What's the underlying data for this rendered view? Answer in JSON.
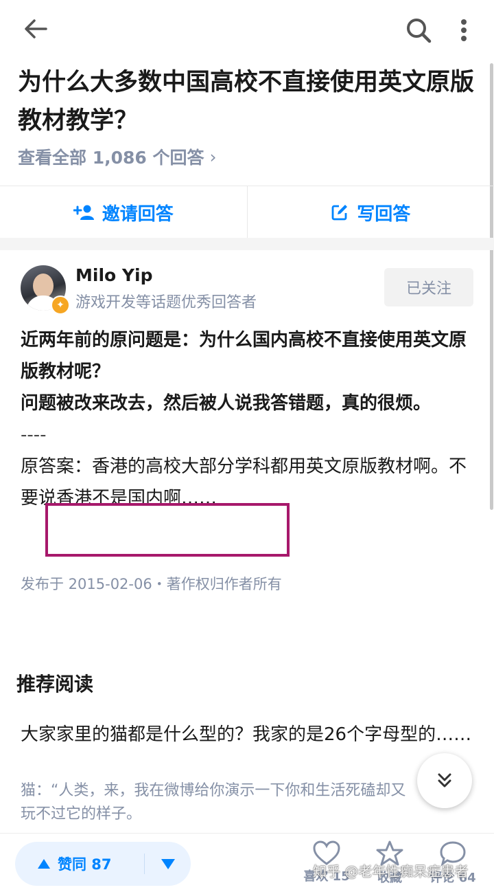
{
  "topbar": {
    "back_icon": "arrow-left-icon",
    "search_icon": "search-icon",
    "more_icon": "more-vertical-icon"
  },
  "question": {
    "title": "为什么大多数中国高校不直接使用英文原版教材教学？",
    "view_all": "查看全部 1,086 个回答",
    "view_all_chevron": "›"
  },
  "actions": {
    "invite_label": "邀请回答",
    "write_label": "写回答"
  },
  "author": {
    "name": "Milo Yip",
    "description": "游戏开发等话题优秀回答者",
    "follow_label": "已关注"
  },
  "answer": {
    "para1": "近两年前的原问题是：为什么国内高校不直接使用英文原版教材呢？",
    "para2": "问题被改来改去，然后被人说我答错题，真的很烦。",
    "divider": "----",
    "para3": "原答案：香港的高校大部分学科都用英文原版教材啊。不要说香港不是国内啊……",
    "meta": "发布于 2015-02-06・著作权归作者所有"
  },
  "recommend": {
    "heading": "推荐阅读",
    "question": "大家家里的猫都是什么型的？我家的是26个字母型的……",
    "excerpt": "猫：“人类，来，我在微博给你演示一下你和生活死磕却又玩不过它的样子。"
  },
  "bottom_bar": {
    "agree_label": "赞同 87",
    "like_label": "喜欢 15",
    "collect_label": "收藏",
    "comment_label": "评论 64"
  },
  "watermark": "知乎 @老年性痴呆症患者",
  "colors": {
    "accent": "#0084ff",
    "secondary_text": "#8590a6",
    "highlight_box": "#a7186b"
  }
}
